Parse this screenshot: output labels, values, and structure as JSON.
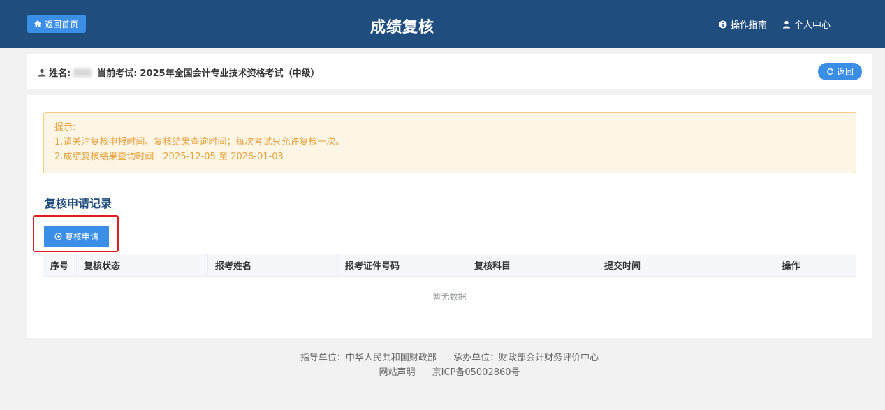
{
  "header": {
    "home_label": "返回首页",
    "title": "成绩复核",
    "guide_label": "操作指南",
    "profile_label": "个人中心"
  },
  "info": {
    "name_label": "姓名:",
    "exam_label": "当前考试:",
    "exam_name": "2025年全国会计专业技术资格考试（中级）",
    "back_label": "返回"
  },
  "notice": {
    "title": "提示:",
    "line1": "1.请关注复核申报时间、复核结果查询时间；每次考试只允许复核一次。",
    "line2": "2.成绩复核结果查询时间：2025-12-05 至 2026-01-03"
  },
  "tab": {
    "label": "复核申请记录"
  },
  "apply_button": {
    "label": "复核申请"
  },
  "table": {
    "columns": [
      "序号",
      "复核状态",
      "报考姓名",
      "报考证件号码",
      "复核科目",
      "提交时间",
      "操作"
    ],
    "empty_text": "暂无数据"
  },
  "footer": {
    "guide_unit": "指导单位：中华人民共和国财政部",
    "host_unit": "承办单位：财政部会计财务评价中心",
    "statement": "网站声明",
    "icp": "京ICP备05002860号"
  },
  "colors": {
    "header_bg": "#1f4e7e",
    "primary": "#3a8ee6",
    "notice_text": "#e6a23c",
    "highlight_border": "#e02020"
  }
}
